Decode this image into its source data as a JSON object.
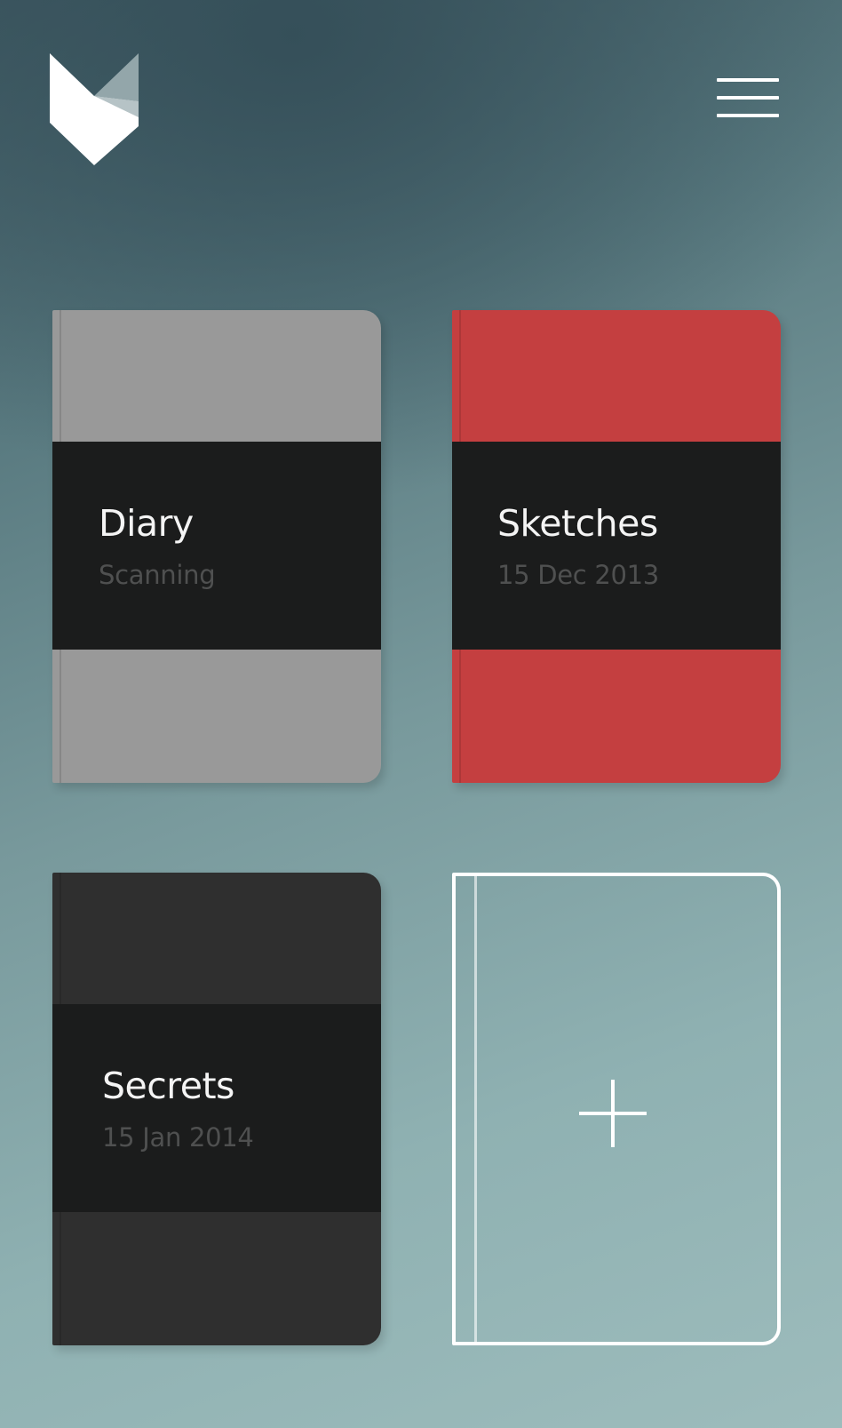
{
  "app": {
    "logo_icon": "folded-paper-logo-icon",
    "menu_icon": "hamburger-menu-icon"
  },
  "notebooks": [
    {
      "title": "Diary",
      "subtitle": "Scanning",
      "cover_color": "#999999"
    },
    {
      "title": "Sketches",
      "subtitle": "15 Dec 2013",
      "cover_color": "#c43f40"
    },
    {
      "title": "Secrets",
      "subtitle": "15 Jan 2014",
      "cover_color": "#2f2f2f"
    }
  ],
  "add_notebook": {
    "icon": "plus-icon"
  },
  "colors": {
    "band": "#1b1c1c",
    "title_text": "#f4f4f4",
    "subtitle_text": "#4f5050",
    "outline": "#ffffff"
  }
}
